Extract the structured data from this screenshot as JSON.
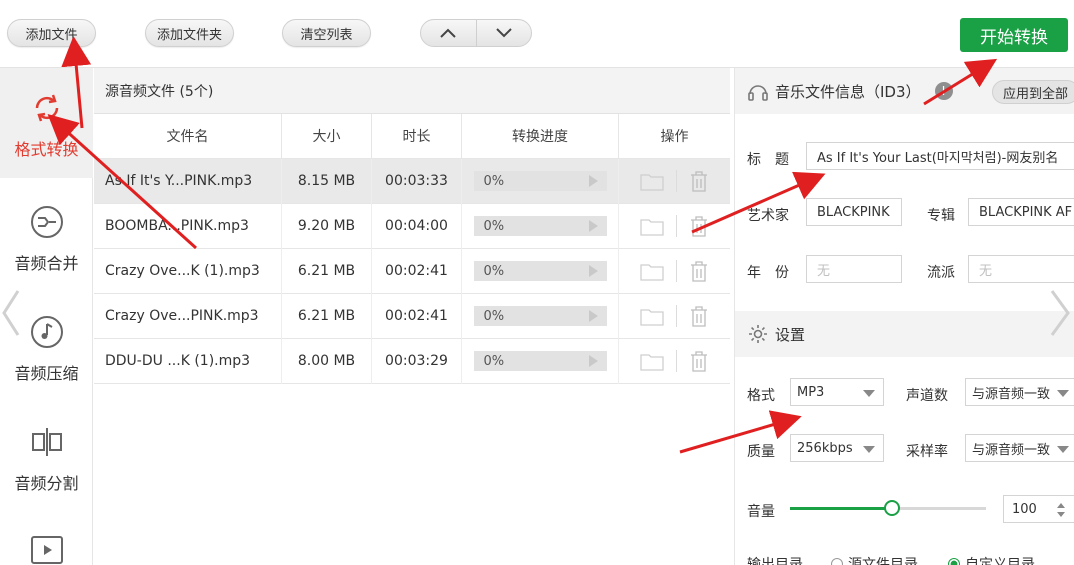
{
  "toolbar": {
    "add_file": "添加文件",
    "add_folder": "添加文件夹",
    "clear_list": "清空列表",
    "move_up": "∧",
    "move_down": "∨",
    "start": "开始转换"
  },
  "sidebar": {
    "items": [
      {
        "label": "格式转换",
        "icon": "refresh-icon",
        "active": true
      },
      {
        "label": "音频合并",
        "icon": "merge-icon"
      },
      {
        "label": "音频压缩",
        "icon": "music-note-icon"
      },
      {
        "label": "音频分割",
        "icon": "split-icon"
      },
      {
        "label": "",
        "icon": "video-play-icon"
      }
    ]
  },
  "table": {
    "title": "源音频文件 (5个)",
    "columns": [
      "文件名",
      "大小",
      "时长",
      "转换进度",
      "操作"
    ],
    "rows": [
      {
        "name": "As If It's Y...PINK.mp3",
        "size": "8.15 MB",
        "duration": "00:03:33",
        "progress": "0%"
      },
      {
        "name": "BOOMBA...PINK.mp3",
        "size": "9.20 MB",
        "duration": "00:04:00",
        "progress": "0%"
      },
      {
        "name": "Crazy Ove...K (1).mp3",
        "size": "6.21 MB",
        "duration": "00:02:41",
        "progress": "0%"
      },
      {
        "name": "Crazy Ove...PINK.mp3",
        "size": "6.21 MB",
        "duration": "00:02:41",
        "progress": "0%"
      },
      {
        "name": "DDU-DU ...K (1).mp3",
        "size": "8.00 MB",
        "duration": "00:03:29",
        "progress": "0%"
      }
    ]
  },
  "info": {
    "header": "音乐文件信息（ID3）",
    "help": "!",
    "apply_all": "应用到全部",
    "title_label": "标　题",
    "title_value": "As If It's Your Last(마지막처럼)-网友别名",
    "artist_label": "艺术家",
    "artist_value": "BLACKPINK",
    "album_label": "专辑",
    "album_value": "BLACKPINK AF",
    "year_label": "年　份",
    "year_placeholder": "无",
    "genre_label": "流派",
    "genre_placeholder": "无"
  },
  "settings": {
    "header": "设置",
    "format_label": "格式",
    "format_value": "MP3",
    "channels_label": "声道数",
    "channels_value": "与源音频一致",
    "quality_label": "质量",
    "quality_value": "256kbps",
    "samplerate_label": "采样率",
    "samplerate_value": "与源音频一致",
    "volume_label": "音量",
    "volume_value": "100",
    "volume_level": 0.52,
    "output_label": "输出目录",
    "output_opt1": "源文件目录",
    "output_opt2": "自定义目录"
  },
  "colors": {
    "accent": "#1aa045",
    "active": "#e23b30",
    "annotation": "#e02020"
  }
}
